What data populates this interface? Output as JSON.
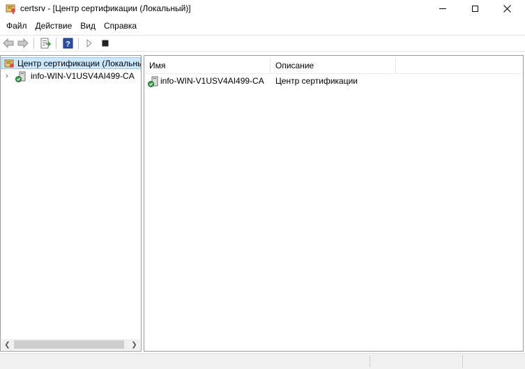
{
  "window": {
    "title": "certsrv - [Центр сертификации (Локальный)]"
  },
  "menu": {
    "items": [
      "Файл",
      "Действие",
      "Вид",
      "Справка"
    ]
  },
  "toolbar": {
    "buttons": [
      "back-arrow-icon",
      "forward-arrow-icon",
      "export-list-icon",
      "help-icon",
      "start-service-icon",
      "stop-service-icon"
    ]
  },
  "tree": {
    "root_label": "Центр сертификации (Локальны",
    "child_label": "info-WIN-V1USV4AI499-CA"
  },
  "list": {
    "columns": [
      "Имя",
      "Описание"
    ],
    "rows": [
      {
        "name": "info-WIN-V1USV4AI499-CA",
        "description": "Центр сертификации"
      }
    ]
  },
  "colors": {
    "selection": "#cce8ff",
    "help_icon": "#2b4fa8"
  }
}
